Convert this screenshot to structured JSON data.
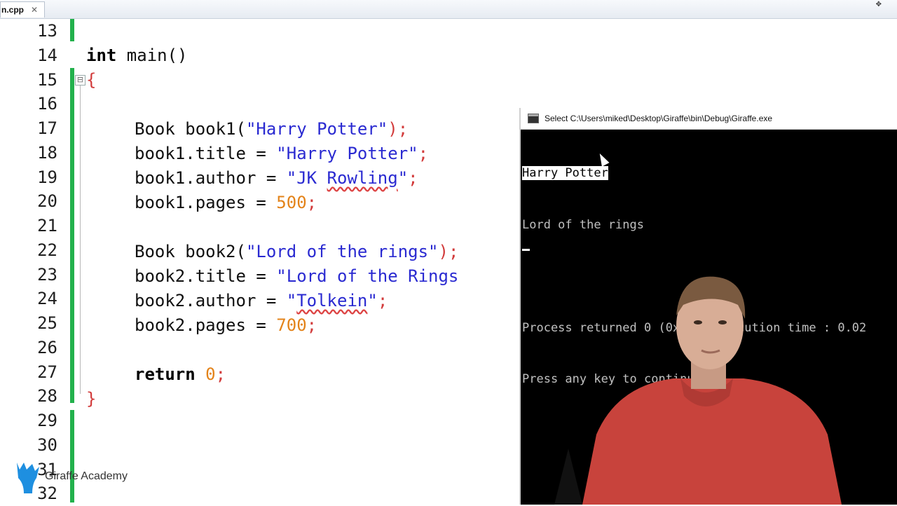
{
  "tab": {
    "label": "n.cpp",
    "close": "✕"
  },
  "window_controls": "✥",
  "lines": [
    {
      "n": "13"
    },
    {
      "n": "14"
    },
    {
      "n": "15"
    },
    {
      "n": "16"
    },
    {
      "n": "17"
    },
    {
      "n": "18"
    },
    {
      "n": "19"
    },
    {
      "n": "20"
    },
    {
      "n": "21"
    },
    {
      "n": "22"
    },
    {
      "n": "23"
    },
    {
      "n": "24"
    },
    {
      "n": "25"
    },
    {
      "n": "26"
    },
    {
      "n": "27"
    },
    {
      "n": "28"
    },
    {
      "n": "29"
    },
    {
      "n": "30"
    },
    {
      "n": "31"
    },
    {
      "n": "32"
    }
  ],
  "code": {
    "l14": {
      "kw": "int",
      "rest": " main()"
    },
    "l15": "{",
    "l17": {
      "a": "Book book1(",
      "s": "\"Harry Potter\"",
      "b": ");"
    },
    "l18": {
      "a": "book1.title = ",
      "s": "\"Harry Potter\"",
      "b": ";"
    },
    "l19": {
      "a": "book1.author = ",
      "s1": "\"JK ",
      "sq": "Rowling",
      "s2": "\"",
      "b": ";"
    },
    "l20": {
      "a": "book1.pages = ",
      "num": "500",
      "b": ";"
    },
    "l22": {
      "a": "Book book2(",
      "s": "\"Lord of the rings\"",
      "b": ");"
    },
    "l23": {
      "a": "book2.title = ",
      "s": "\"Lord of the Rings"
    },
    "l24": {
      "a": "book2.author = ",
      "s1": "\"",
      "sq": "Tolkein",
      "s2": "\"",
      "b": ";"
    },
    "l25": {
      "a": "book2.pages = ",
      "num": "700",
      "b": ";"
    },
    "l27": {
      "kw": "return",
      "num": "0",
      "b": ";"
    },
    "l28": "}"
  },
  "console": {
    "title": "Select C:\\Users\\miked\\Desktop\\Giraffe\\bin\\Debug\\Giraffe.exe",
    "output_line1": "Harry Potter",
    "output_line2": "Lord of the rings",
    "blank": "",
    "process_line": "Process returned 0 (0x0)   execution time : 0.02",
    "continue_line": "Press any key to continue."
  },
  "brand": {
    "name": "Giraffe Academy",
    "icon": "giraffe-logo",
    "color": "#1e8fe0"
  },
  "colors": {
    "string": "#2a2ad1",
    "number": "#e3831a",
    "operator": "#d23b3b",
    "changebar": "#22b14c"
  }
}
